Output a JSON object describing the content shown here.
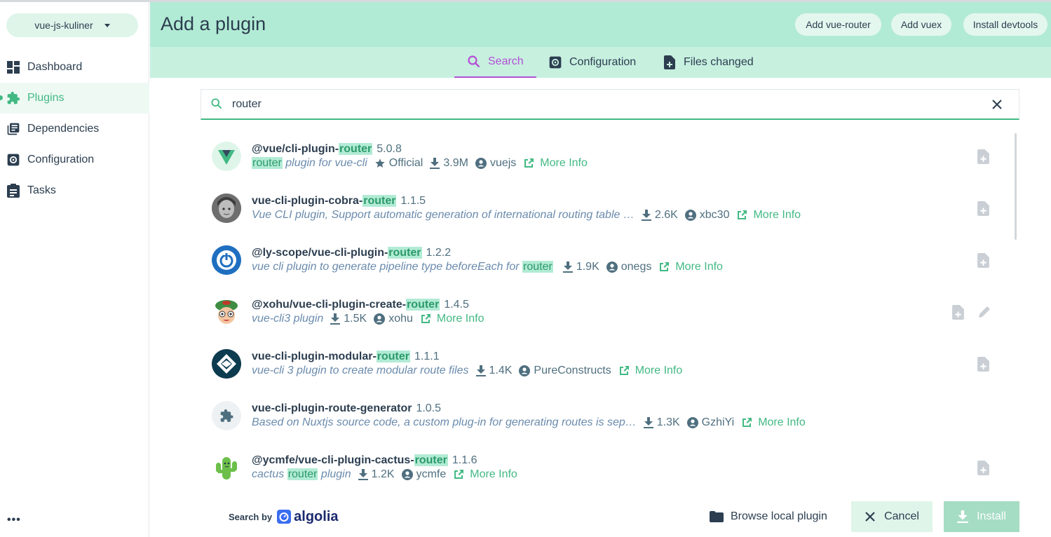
{
  "sidebar": {
    "project": "vue-js-kuliner",
    "items": [
      {
        "label": "Dashboard",
        "icon": "dashboard-icon"
      },
      {
        "label": "Plugins",
        "icon": "puzzle-icon",
        "active": true
      },
      {
        "label": "Dependencies",
        "icon": "library-books-icon"
      },
      {
        "label": "Configuration",
        "icon": "settings-icon"
      },
      {
        "label": "Tasks",
        "icon": "clipboard-icon"
      }
    ],
    "more": "•••"
  },
  "header": {
    "title": "Add a plugin",
    "buttons": [
      "Add vue-router",
      "Add vuex",
      "Install devtools"
    ]
  },
  "tabs": [
    {
      "label": "Search",
      "icon": "search-icon",
      "active": true
    },
    {
      "label": "Configuration",
      "icon": "settings-icon"
    },
    {
      "label": "Files changed",
      "icon": "file-plus-icon"
    }
  ],
  "search": {
    "value": "router",
    "placeholder": ""
  },
  "plugins": [
    {
      "name_prefix": "@vue/cli-plugin-",
      "name_hl": "router",
      "version": "5.0.8",
      "desc_hl": "router",
      "desc": " plugin for vue-cli",
      "official": "Official",
      "downloads": "3.9M",
      "author": "vuejs",
      "more": "More Info",
      "avatar": "vue-logo"
    },
    {
      "name_prefix": "vue-cli-plugin-cobra-",
      "name_hl": "router",
      "version": "1.1.5",
      "desc": "Vue CLI plugin, Support automatic generation of international routing table …",
      "downloads": "2.6K",
      "author": "xbc30",
      "more": "More Info",
      "avatar": "photo"
    },
    {
      "name_prefix": "@ly-scope/vue-cli-plugin-",
      "name_hl": "router",
      "version": "1.2.2",
      "desc": "vue cli plugin to generate pipeline type beforeEach for ",
      "desc_hl_end": "router",
      "downloads": "1.9K",
      "author": "onegs",
      "more": "More Info",
      "avatar": "power-logo"
    },
    {
      "name_prefix": "@xohu/vue-cli-plugin-create-",
      "name_hl": "router",
      "version": "1.4.5",
      "desc": "vue-cli3 plugin",
      "downloads": "1.5K",
      "author": "xohu",
      "more": "More Info",
      "avatar": "cartoon"
    },
    {
      "name_prefix": "vue-cli-plugin-modular-",
      "name_hl": "router",
      "version": "1.1.1",
      "desc": "vue-cli 3 plugin to create modular route files",
      "downloads": "1.4K",
      "author": "PureConstructs",
      "more": "More Info",
      "avatar": "modular-logo"
    },
    {
      "name_prefix": "vue-cli-plugin-route-generator",
      "name_hl": "",
      "version": "1.0.5",
      "desc": "Based on Nuxtjs source code, a custom plug-in for generating routes is sep…",
      "downloads": "1.3K",
      "author": "GzhiYi",
      "more": "More Info",
      "avatar": "puzzle-default"
    },
    {
      "name_prefix": "@ycmfe/vue-cli-plugin-cactus-",
      "name_hl": "router",
      "version": "1.1.6",
      "desc": "cactus ",
      "desc_mid_hl": "router",
      "desc_after": " plugin",
      "downloads": "1.2K",
      "author": "ycmfe",
      "more": "More Info",
      "avatar": "cactus"
    }
  ],
  "footer": {
    "search_by": "Search by",
    "algolia": "algolia",
    "browse": "Browse local plugin",
    "cancel": "Cancel",
    "install": "Install"
  },
  "colors": {
    "accent": "#42b983",
    "header": "#b2ebd5",
    "tabbar": "#c7f0df",
    "active_tab": "#b44fd6",
    "text": "#2c3e50"
  }
}
